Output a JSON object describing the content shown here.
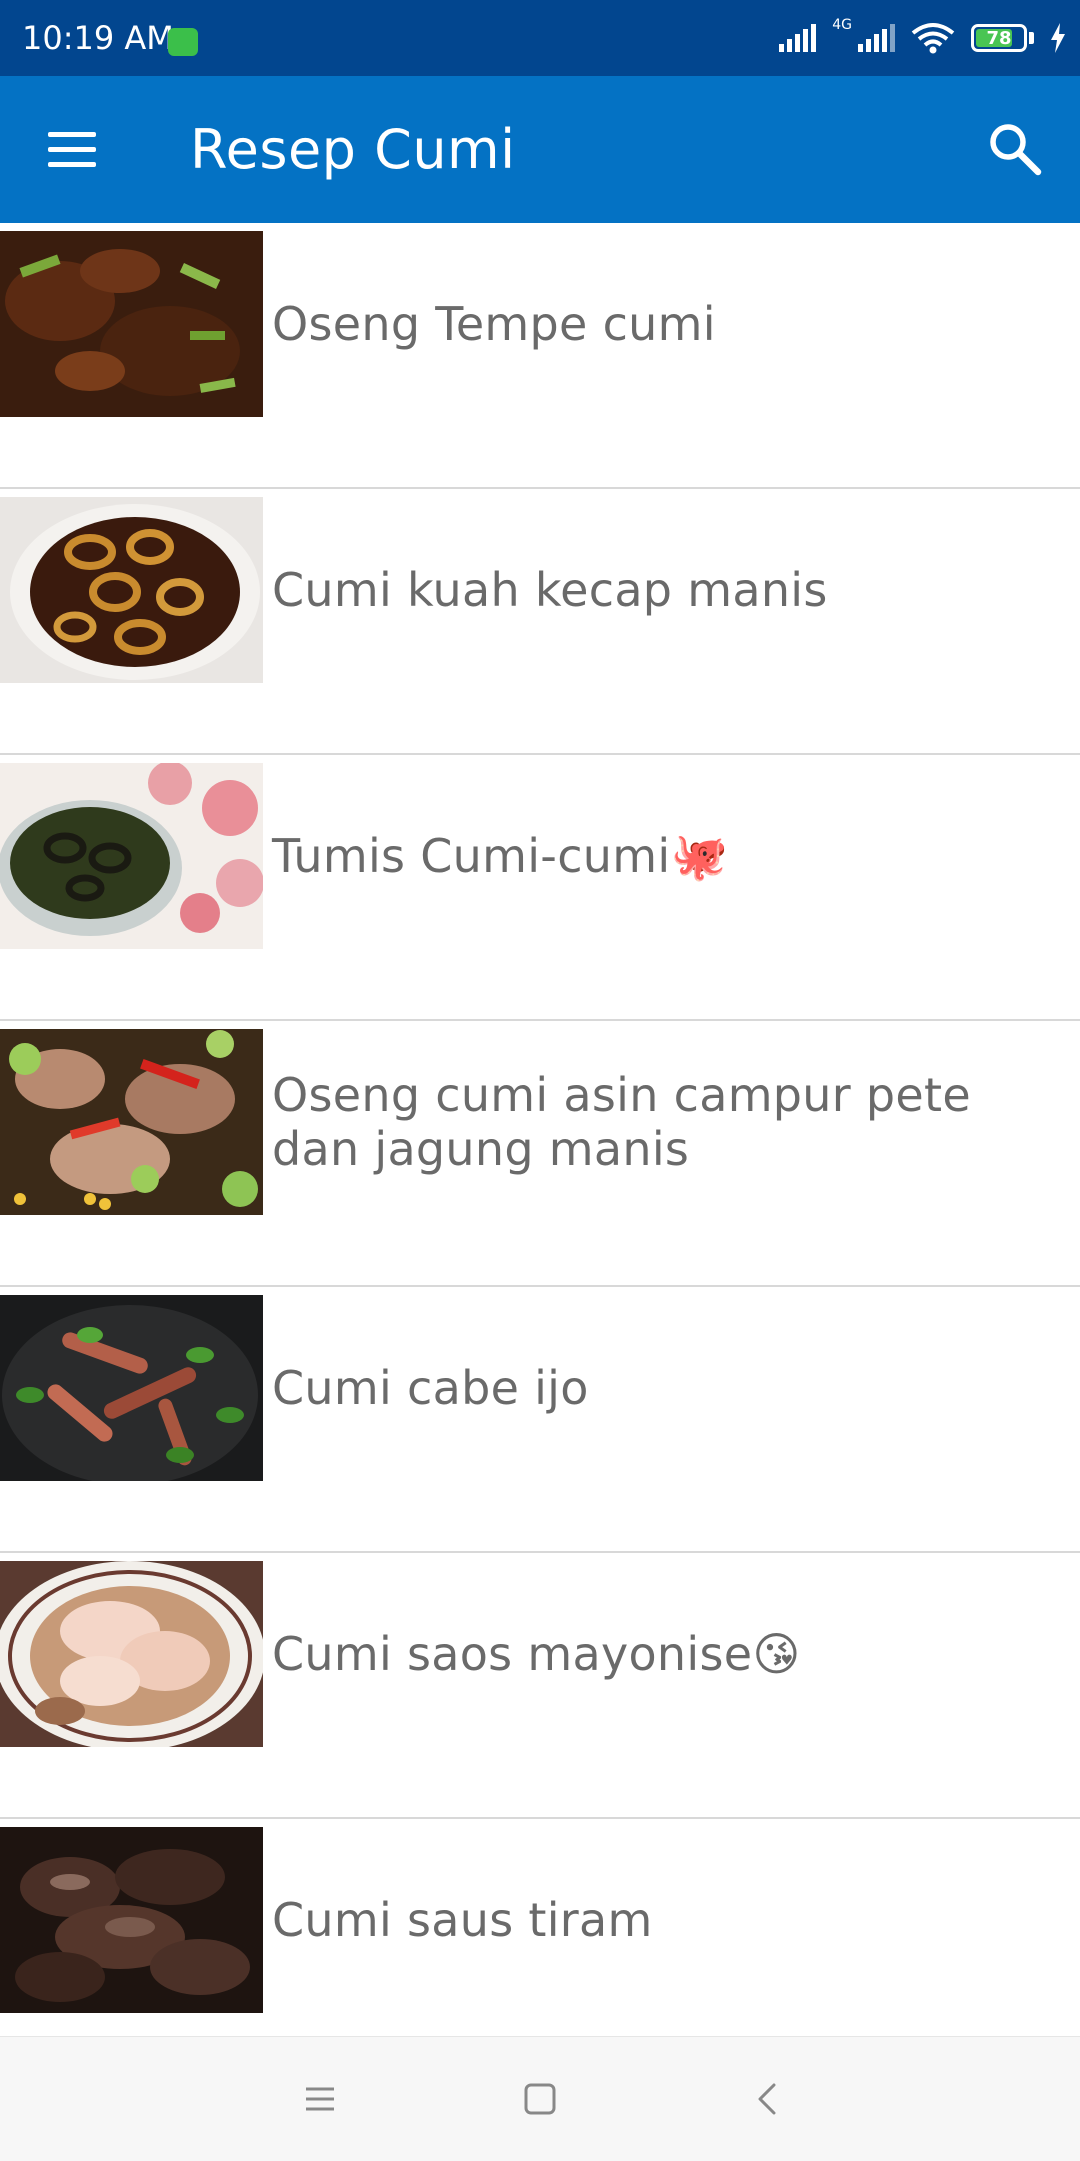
{
  "status_bar": {
    "time": "10:19 AM",
    "network": "4G",
    "battery": "78",
    "battery_level": 0.78
  },
  "app_bar": {
    "title": "Resep Cumi",
    "menu_icon": "hamburger-menu-icon",
    "search_icon": "search-icon"
  },
  "recipes": [
    {
      "title": "Oseng Tempe cumi"
    },
    {
      "title": "Cumi kuah kecap manis"
    },
    {
      "title": "Tumis Cumi-cumi🐙"
    },
    {
      "title": "Oseng cumi asin campur pete dan jagung manis"
    },
    {
      "title": "Cumi cabe ijo"
    },
    {
      "title": "Cumi saos mayonise😘"
    },
    {
      "title": "Cumi saus tiram"
    }
  ],
  "nav_bar": {
    "recents_icon": "recents-icon",
    "home_icon": "home-icon",
    "back_icon": "back-icon"
  },
  "colors": {
    "status_bar": "#02468f",
    "app_bar": "#0472c4",
    "item_text": "#6a6a6a"
  }
}
